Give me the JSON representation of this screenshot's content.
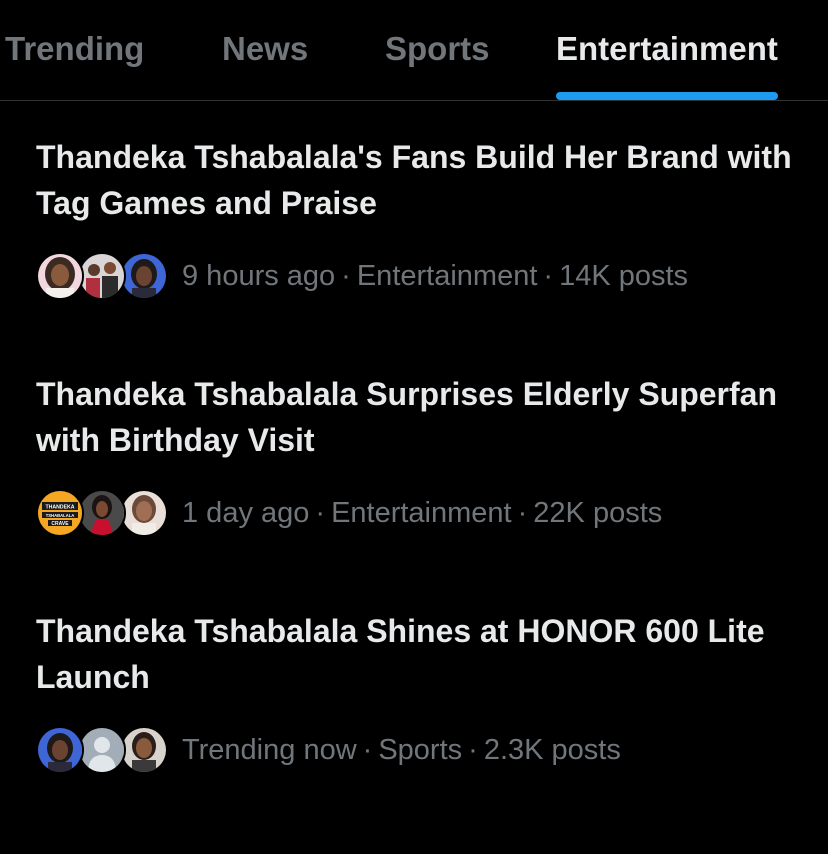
{
  "tabs": [
    {
      "label": "Trending",
      "active": false
    },
    {
      "label": "News",
      "active": false
    },
    {
      "label": "Sports",
      "active": false
    },
    {
      "label": "Entertainment",
      "active": true
    }
  ],
  "colors": {
    "background": "#000000",
    "text_primary": "#e7e9ea",
    "text_secondary": "#71767b",
    "accent": "#1d9bf0",
    "divider": "#2f3336"
  },
  "stories": [
    {
      "headline": "Thandeka Tshabalala's Fans Build Her Brand with Tag Games and Praise",
      "time": "9 hours ago",
      "category": "Entertainment",
      "posts": "14K posts",
      "avatars": [
        "woman-portrait-avatar",
        "group-photo-avatar",
        "woman-blue-background-avatar"
      ]
    },
    {
      "headline": "Thandeka Tshabalala Surprises Elderly Superfan with Birthday Visit",
      "time": "1 day ago",
      "category": "Entertainment",
      "posts": "22K posts",
      "avatars": [
        "fan-club-logo-avatar",
        "woman-red-dress-avatar",
        "woman-portrait-avatar"
      ],
      "logo_text": [
        "THANDEKA",
        "TSHABALALA",
        "CRAVE"
      ]
    },
    {
      "headline": "Thandeka Tshabalala Shines at HONOR 600 Lite Launch",
      "time": "Trending now",
      "category": "Sports",
      "posts": "2.3K posts",
      "avatars": [
        "woman-blue-background-avatar",
        "default-user-avatar",
        "woman-portrait-avatar"
      ]
    }
  ]
}
